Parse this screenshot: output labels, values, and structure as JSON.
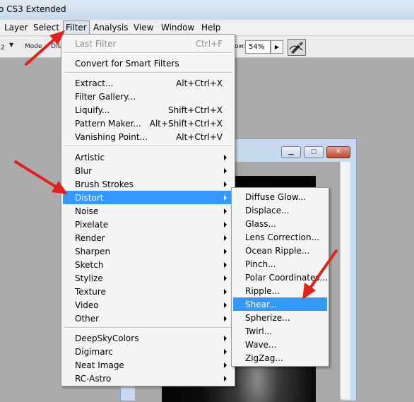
{
  "app": {
    "title": "o CS3 Extended"
  },
  "menubar": {
    "items": [
      "Layer",
      "Select",
      "Filter",
      "Analysis",
      "View",
      "Window",
      "Help"
    ]
  },
  "optionsbar": {
    "mode_label": "Mode",
    "dis_label": "Dis",
    "small_label": "2",
    "ow_label": "ow:",
    "zoom": "54%"
  },
  "filter_menu": {
    "last_filter": "Last Filter",
    "last_filter_shortcut": "Ctrl+F",
    "convert": "Convert for Smart Filters",
    "tools": [
      {
        "label": "Extract...",
        "shortcut": "Alt+Ctrl+X"
      },
      {
        "label": "Filter Gallery...",
        "shortcut": ""
      },
      {
        "label": "Liquify...",
        "shortcut": "Shift+Ctrl+X"
      },
      {
        "label": "Pattern Maker...",
        "shortcut": "Alt+Shift+Ctrl+X"
      },
      {
        "label": "Vanishing Point...",
        "shortcut": "Alt+Ctrl+V"
      }
    ],
    "categories": [
      "Artistic",
      "Blur",
      "Brush Strokes",
      "Distort",
      "Noise",
      "Pixelate",
      "Render",
      "Sharpen",
      "Sketch",
      "Stylize",
      "Texture",
      "Video",
      "Other"
    ],
    "plugins": [
      "DeepSkyColors",
      "Digimarc",
      "Neat Image",
      "RC-Astro"
    ]
  },
  "distort_menu": {
    "items": [
      "Diffuse Glow...",
      "Displace...",
      "Glass...",
      "Lens Correction...",
      "Ocean Ripple...",
      "Pinch...",
      "Polar Coordinates...",
      "Ripple...",
      "Shear...",
      "Spherize...",
      "Twirl...",
      "Wave...",
      "ZigZag..."
    ]
  },
  "colors": {
    "highlight": "#3399ff",
    "annotation_arrow": "#e0221b"
  },
  "icons": {
    "submenu": "submenu-arrow-icon",
    "annotation": "red-arrow-icon"
  }
}
